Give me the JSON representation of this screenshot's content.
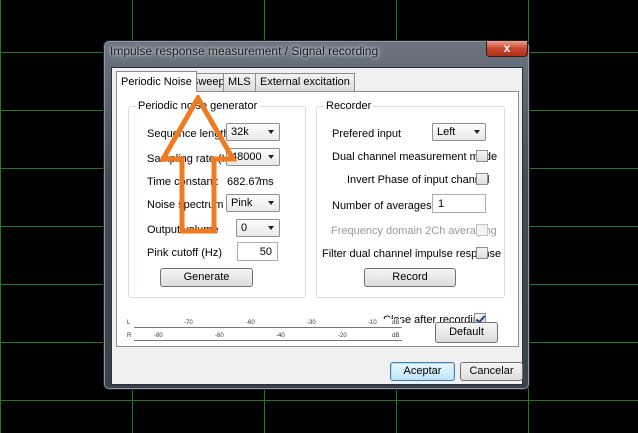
{
  "window": {
    "title": "Impulse response measurement / Signal recording",
    "close_glyph": "x"
  },
  "tabs": [
    {
      "label": "Periodic Noise",
      "active": true
    },
    {
      "label": "Sweep",
      "active": false
    },
    {
      "label": "MLS",
      "active": false
    },
    {
      "label": "External excitation",
      "active": false
    }
  ],
  "generator": {
    "group_label": "Periodic noise generator",
    "sequence_length": {
      "label": "Sequence length",
      "value": "32k"
    },
    "sampling_rate": {
      "label": "Sampling rate (Hz)",
      "value": "48000"
    },
    "time_constant": {
      "label": "Time constant:",
      "value": "682.67",
      "unit": "ms"
    },
    "noise_spectrum": {
      "label": "Noise spectrum",
      "value": "Pink"
    },
    "output_volume": {
      "label": "Output volume",
      "value": "0"
    },
    "pink_cutoff": {
      "label": "Pink cutoff (Hz)",
      "value": "50"
    },
    "generate_label": "Generate"
  },
  "recorder": {
    "group_label": "Recorder",
    "preferred_input": {
      "label": "Prefered input",
      "value": "Left"
    },
    "dual_channel": {
      "label": "Dual channel measurement mode",
      "checked": false
    },
    "invert_phase": {
      "label": "Invert Phase of input channel",
      "checked": false
    },
    "averages": {
      "label": "Number of averages",
      "value": "1"
    },
    "freq_domain": {
      "label": "Frequency domain 2Ch averaging",
      "checked": false,
      "disabled": true
    },
    "filter_dual": {
      "label": "Filter dual channel impulse response",
      "checked": false
    },
    "record_label": "Record"
  },
  "close_after": {
    "label": "Close after recording",
    "checked": true
  },
  "meter": {
    "left_channel": "L",
    "right_channel": "R",
    "top_ticks": [
      "-70",
      "-60",
      "-30",
      "-10",
      "dB"
    ],
    "bottom_ticks": [
      "-80",
      "-60",
      "-40",
      "-20",
      "dB"
    ]
  },
  "buttons": {
    "default_label": "Default",
    "ok_label": "Aceptar",
    "cancel_label": "Cancelar"
  },
  "colors": {
    "arrow_orange": "#f07a1f",
    "grid_green": "#1d7a1d"
  }
}
